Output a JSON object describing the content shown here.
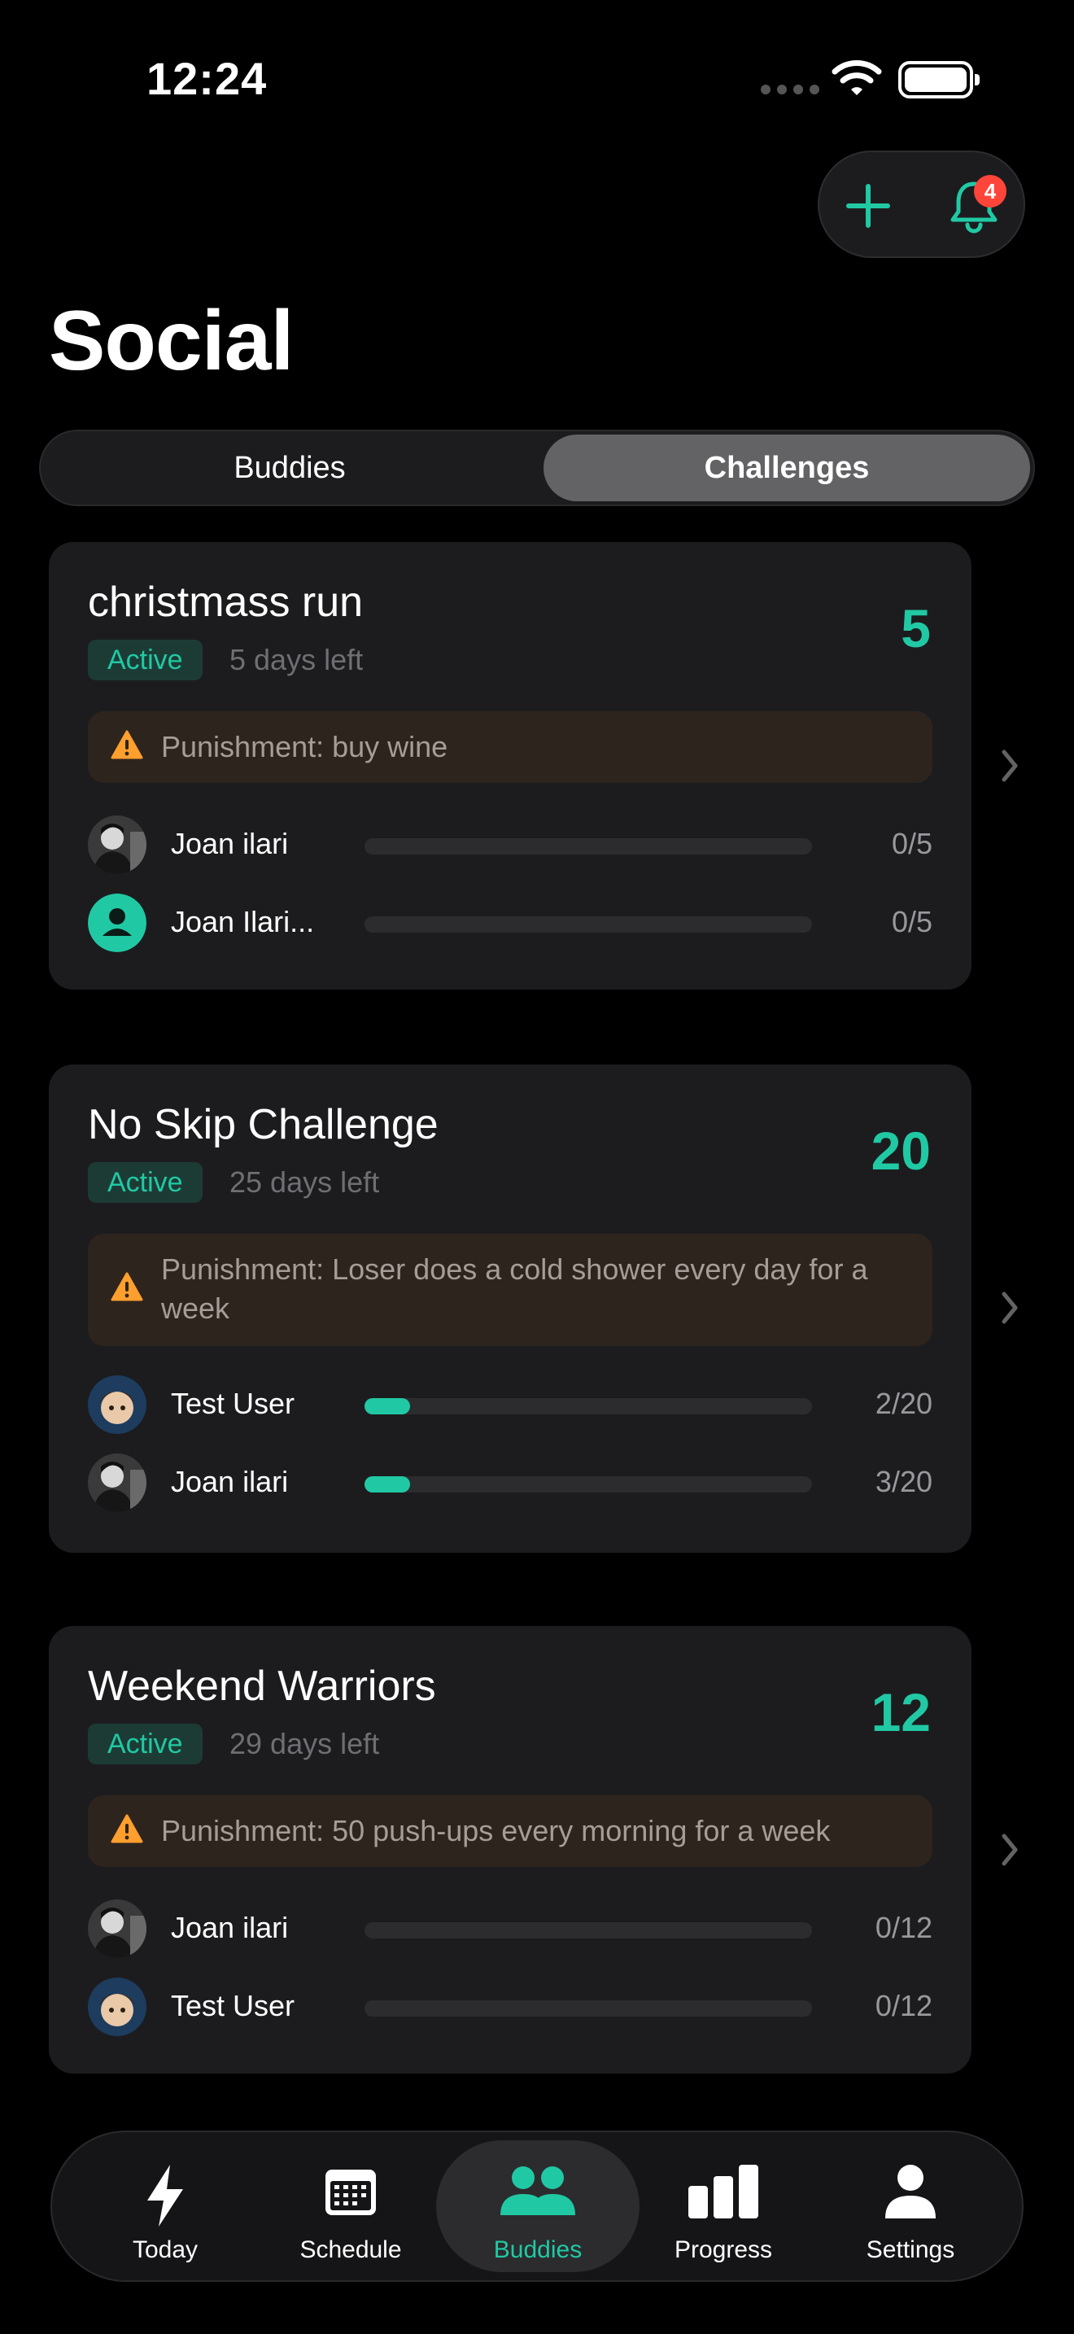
{
  "status_bar": {
    "time": "12:24"
  },
  "header": {
    "notification_count": "4"
  },
  "page_title": "Social",
  "segmented": {
    "buddies": "Buddies",
    "challenges": "Challenges",
    "selected": "Challenges"
  },
  "challenges": [
    {
      "title": "christmass run",
      "target": "5",
      "status": "Active",
      "days_left": "5 days left",
      "punishment": "Punishment: buy wine",
      "members": [
        {
          "name": "Joan ilari",
          "progress": "0/5",
          "fraction": 0,
          "avatar": "photo-bw"
        },
        {
          "name": "Joan Ilari...",
          "progress": "0/5",
          "fraction": 0,
          "avatar": "person-icon"
        }
      ]
    },
    {
      "title": "No Skip Challenge",
      "target": "20",
      "status": "Active",
      "days_left": "25 days left",
      "punishment": "Punishment: Loser does a cold shower every day for a week",
      "members": [
        {
          "name": "Test User",
          "progress": "2/20",
          "fraction": 0.1,
          "avatar": "photo-child"
        },
        {
          "name": "Joan ilari",
          "progress": "3/20",
          "fraction": 0.15,
          "avatar": "photo-bw"
        }
      ]
    },
    {
      "title": "Weekend Warriors",
      "target": "12",
      "status": "Active",
      "days_left": "29 days left",
      "punishment": "Punishment: 50 push-ups every morning for a week",
      "members": [
        {
          "name": "Joan ilari",
          "progress": "0/12",
          "fraction": 0,
          "avatar": "photo-bw"
        },
        {
          "name": "Test User",
          "progress": "0/12",
          "fraction": 0,
          "avatar": "photo-child"
        }
      ]
    }
  ],
  "tabs": [
    {
      "label": "Today",
      "icon": "bolt-icon"
    },
    {
      "label": "Schedule",
      "icon": "calendar-icon"
    },
    {
      "label": "Buddies",
      "icon": "people-icon",
      "active": true
    },
    {
      "label": "Progress",
      "icon": "bar-chart-icon"
    },
    {
      "label": "Settings",
      "icon": "person-icon"
    }
  ],
  "colors": {
    "accent": "#20c9a4",
    "warning": "#ff9f2e",
    "badge": "#ff453a",
    "card": "#1c1c1e",
    "background": "#000000"
  }
}
